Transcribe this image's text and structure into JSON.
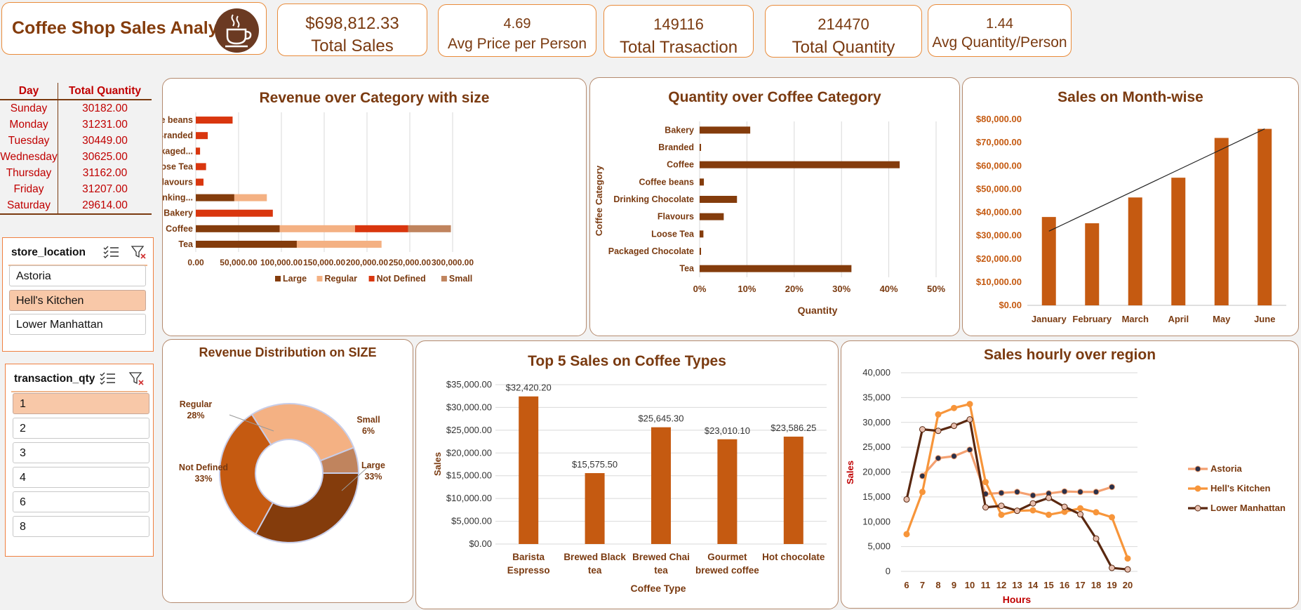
{
  "title": "Coffee Shop Sales Analysis",
  "kpis": [
    {
      "value": "$698,812.33",
      "label": "Total Sales"
    },
    {
      "value": "4.69",
      "label": "Avg Price per Person"
    },
    {
      "value": "149116",
      "label": "Total Trasaction"
    },
    {
      "value": "214470",
      "label": "Total Quantity"
    },
    {
      "value": "1.44",
      "label": "Avg Quantity/Person"
    }
  ],
  "day_table": {
    "headers": [
      "Day",
      "Total Quantity"
    ],
    "rows": [
      [
        "Sunday",
        "30182.00"
      ],
      [
        "Monday",
        "31231.00"
      ],
      [
        "Tuesday",
        "30449.00"
      ],
      [
        "Wednesday",
        "30625.00"
      ],
      [
        "Thursday",
        "31162.00"
      ],
      [
        "Friday",
        "31207.00"
      ],
      [
        "Saturday",
        "29614.00"
      ]
    ]
  },
  "slicers": [
    {
      "header": "store_location",
      "items": [
        "Astoria",
        "Hell's Kitchen",
        "Lower Manhattan"
      ],
      "selected": [
        "Hell's Kitchen"
      ]
    },
    {
      "header": "transaction_qty",
      "items": [
        "1",
        "2",
        "3",
        "4",
        "6",
        "8"
      ],
      "selected": [
        "1"
      ]
    }
  ],
  "colors": {
    "large": "#843c0c",
    "regular": "#f4b183",
    "not_defined": "#c55a11",
    "small": "#c0845e",
    "not_defined_bar": "#d9360e",
    "accent": "#c55a11",
    "title": "#7a3a10"
  },
  "chart_data": [
    {
      "type": "bar",
      "orientation": "horizontal",
      "stacked": true,
      "title": "Revenue over Category with size",
      "categories": [
        "Coffee beans",
        "Branded",
        "Packaged...",
        "Loose Tea",
        "Flavours",
        "Drinking...",
        "Bakery",
        "Coffee",
        "Tea"
      ],
      "series": [
        {
          "name": "Large",
          "values": [
            0,
            0,
            0,
            0,
            0,
            45000,
            0,
            98000,
            118000
          ]
        },
        {
          "name": "Regular",
          "values": [
            0,
            0,
            0,
            0,
            0,
            38000,
            0,
            88000,
            99000
          ]
        },
        {
          "name": "Not Defined",
          "values": [
            43000,
            14000,
            5000,
            12000,
            9000,
            0,
            90000,
            62000,
            0
          ]
        },
        {
          "name": "Small",
          "values": [
            0,
            0,
            0,
            0,
            0,
            0,
            0,
            50000,
            0
          ]
        }
      ],
      "xticks": [
        "0.00",
        "50,000.00",
        "100,000.00",
        "150,000.00",
        "200,000.00",
        "250,000.00",
        "300,000.00"
      ],
      "xlim": [
        0,
        300000
      ],
      "legend": "bottom"
    },
    {
      "type": "bar",
      "orientation": "horizontal",
      "title": "Quantity over Coffee Category",
      "xlabel": "Quantity",
      "ylabel": "Coffee Category",
      "categories": [
        "Bakery",
        "Branded",
        "Coffee",
        "Coffee beans",
        "Drinking Chocolate",
        "Flavours",
        "Loose Tea",
        "Packaged Chocolate",
        "Tea"
      ],
      "values": [
        10.7,
        0.3,
        42.3,
        0.9,
        7.9,
        5.1,
        0.8,
        0.3,
        32.1
      ],
      "xticks": [
        "0%",
        "10%",
        "20%",
        "30%",
        "40%",
        "50%"
      ],
      "xlim": [
        0,
        50
      ]
    },
    {
      "type": "bar",
      "title": "Sales on Month-wise",
      "categories": [
        "January",
        "February",
        "March",
        "April",
        "May",
        "June"
      ],
      "values": [
        38000,
        35300,
        46400,
        54900,
        72000,
        75900
      ],
      "yticks": [
        "$0.00",
        "$10,000.00",
        "$20,000.00",
        "$30,000.00",
        "$40,000.00",
        "$50,000.00",
        "$60,000.00",
        "$70,000.00",
        "$80,000.00"
      ],
      "ylim": [
        0,
        80000
      ],
      "trendline": [
        31900,
        40700,
        49500,
        58300,
        67100,
        75900
      ]
    },
    {
      "type": "pie",
      "donut": true,
      "title": "Revenue Distribution on SIZE",
      "slices": [
        {
          "name": "Large",
          "value": 33,
          "label": "33%"
        },
        {
          "name": "Not Defined",
          "value": 33,
          "label": "33%"
        },
        {
          "name": "Regular",
          "value": 28,
          "label": "28%"
        },
        {
          "name": "Small",
          "value": 6,
          "label": "6%"
        }
      ]
    },
    {
      "type": "bar",
      "title": "Top 5 Sales on Coffee Types",
      "xlabel": "Coffee Type",
      "ylabel": "Sales",
      "categories": [
        [
          "Barista",
          "Espresso"
        ],
        [
          "Brewed Black",
          "tea"
        ],
        [
          "Brewed Chai",
          "tea"
        ],
        [
          "Gourmet",
          "brewed coffee"
        ],
        [
          "Hot chocolate"
        ]
      ],
      "values": [
        32420.2,
        15575.5,
        25645.3,
        23010.1,
        23586.25
      ],
      "data_labels": [
        "$32,420.20",
        "$15,575.50",
        "$25,645.30",
        "$23,010.10",
        "$23,586.25"
      ],
      "yticks": [
        "$0.00",
        "$5,000.00",
        "$10,000.00",
        "$15,000.00",
        "$20,000.00",
        "$25,000.00",
        "$30,000.00",
        "$35,000.00"
      ],
      "ylim": [
        0,
        35000
      ]
    },
    {
      "type": "line",
      "title": "Sales hourly over region",
      "xlabel": "Hours",
      "ylabel": "Sales",
      "x": [
        6,
        7,
        8,
        9,
        10,
        11,
        12,
        13,
        14,
        15,
        16,
        17,
        18,
        19,
        20
      ],
      "series": [
        {
          "name": "Astoria",
          "values": [
            null,
            19200,
            22800,
            23200,
            24500,
            15600,
            15800,
            16000,
            15300,
            15700,
            16100,
            16000,
            16000,
            17000,
            null
          ]
        },
        {
          "name": "Hell's Kitchen",
          "values": [
            7500,
            16000,
            31600,
            32900,
            33700,
            18000,
            11400,
            12200,
            12300,
            11400,
            12000,
            12700,
            11900,
            10900,
            2600
          ]
        },
        {
          "name": "Lower Manhattan",
          "values": [
            14500,
            28600,
            28300,
            29300,
            30600,
            12900,
            13200,
            12200,
            13700,
            14800,
            13000,
            11500,
            6600,
            700,
            400
          ]
        }
      ],
      "yticks": [
        "0",
        "5,000",
        "10,000",
        "15,000",
        "20,000",
        "25,000",
        "30,000",
        "35,000",
        "40,000"
      ],
      "ylim": [
        0,
        40000
      ],
      "legend": "right"
    }
  ]
}
